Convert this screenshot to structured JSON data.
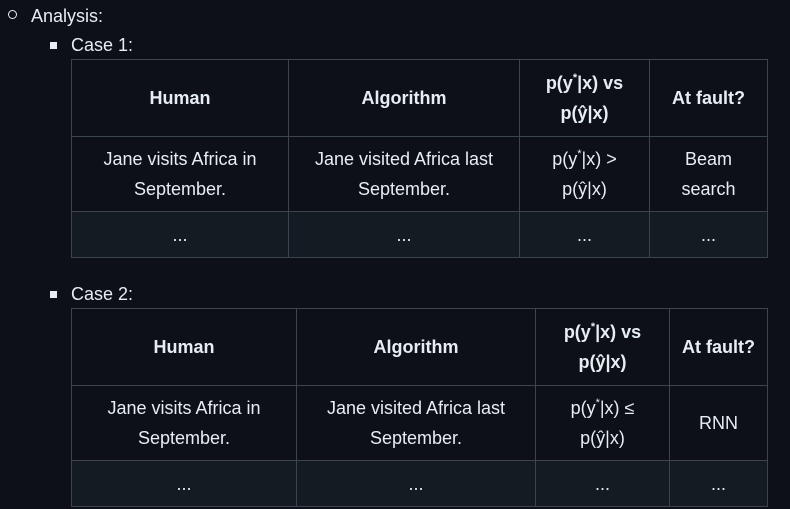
{
  "analysis_label": "Analysis:",
  "cases": [
    {
      "label": "Case 1:",
      "headers": {
        "human": "Human",
        "algorithm": "Algorithm",
        "comparison_line1_a": "p(y",
        "comparison_line1_sup": "*",
        "comparison_line1_b": "|x) vs",
        "comparison_line2": "p(ŷ|x)",
        "fault": "At fault?"
      },
      "row": {
        "human": "Jane visits Africa in September.",
        "algorithm": "Jane visited Africa last September.",
        "comparison_a": "p(y",
        "comparison_sup": "*",
        "comparison_b": "|x) >",
        "comparison_line2": "p(ŷ|x)",
        "fault": "Beam search"
      },
      "ellipsis_row": [
        "...",
        "...",
        "...",
        "..."
      ]
    },
    {
      "label": "Case 2:",
      "headers": {
        "human": "Human",
        "algorithm": "Algorithm",
        "comparison_line1_a": "p(y",
        "comparison_line1_sup": "*",
        "comparison_line1_b": "|x) vs",
        "comparison_line2": "p(ŷ|x)",
        "fault": "At fault?"
      },
      "row": {
        "human": "Jane visits Africa in September.",
        "algorithm": "Jane visited Africa last September.",
        "comparison_a": "p(y",
        "comparison_sup": "*",
        "comparison_b": "|x) ≤",
        "comparison_line2": "p(ŷ|x)",
        "fault": "RNN"
      },
      "ellipsis_row": [
        "...",
        "...",
        "...",
        "..."
      ]
    }
  ]
}
